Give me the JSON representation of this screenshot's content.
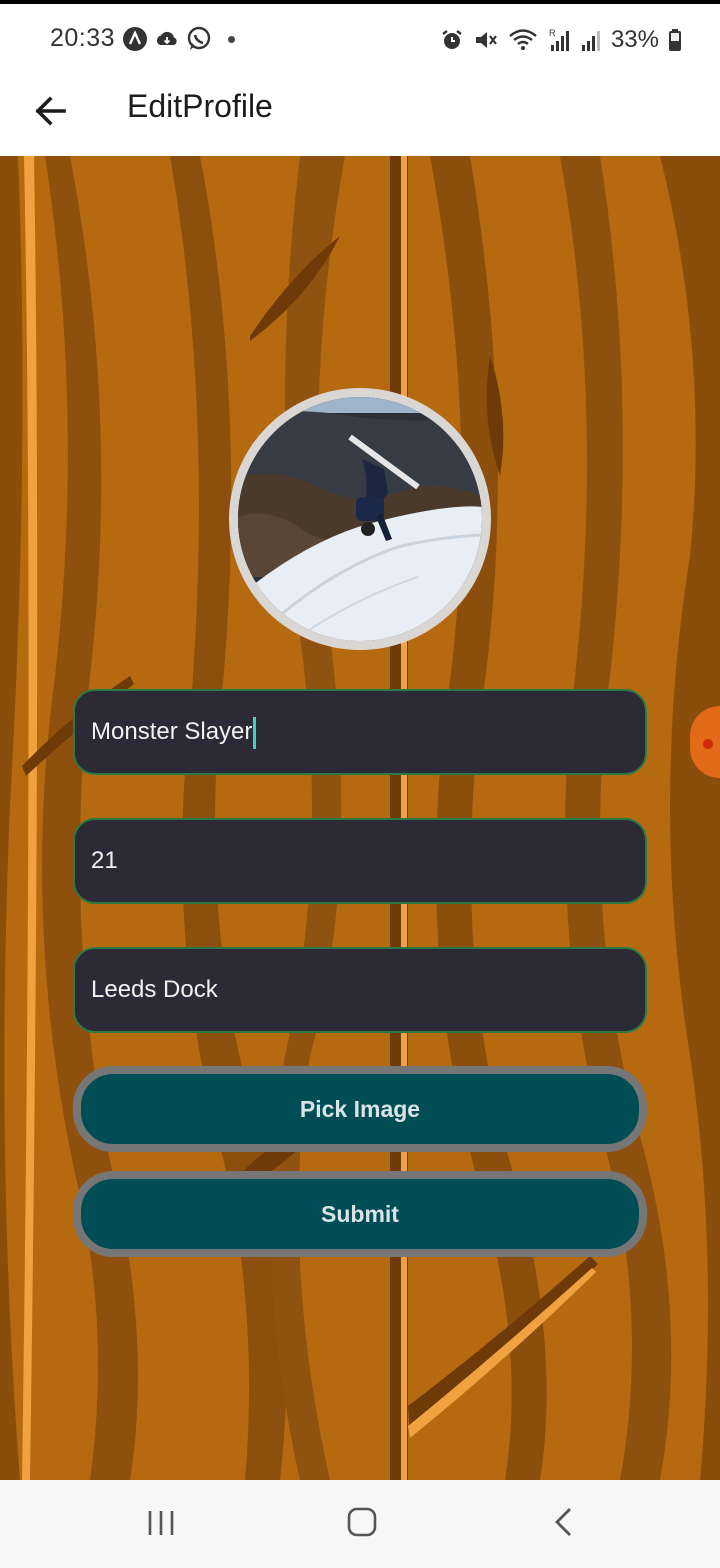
{
  "status_bar": {
    "time": "20:33",
    "battery": "33%",
    "left_icons": [
      "a-circle-icon",
      "cloud-icon",
      "whatsapp-icon"
    ],
    "right_icons": [
      "alarm-icon",
      "mute-icon",
      "wifi-icon",
      "signal-icon",
      "signal-icon",
      "battery-icon"
    ]
  },
  "app_bar": {
    "title": "EditProfile"
  },
  "form": {
    "name_value": "Monster Slayer",
    "age_value": "21",
    "location_value": "Leeds Dock",
    "pick_image_label": "Pick Image",
    "submit_label": "Submit"
  },
  "colors": {
    "wood_background": "#b56a10",
    "field_background": "#2b2a36",
    "field_border": "#2a7a45",
    "button_fill": "#004d56",
    "button_border": "#767676"
  }
}
